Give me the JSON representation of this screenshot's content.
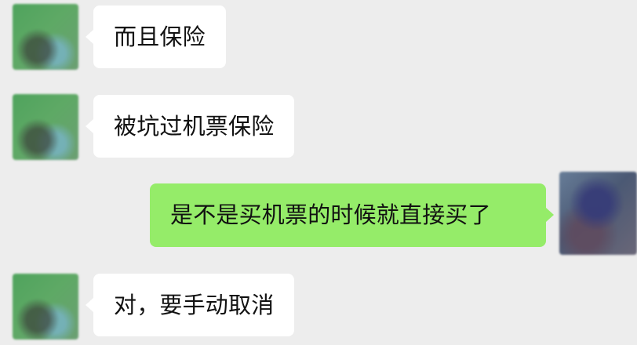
{
  "chat": {
    "messages": [
      {
        "sender": "left",
        "text": "而且保险"
      },
      {
        "sender": "left",
        "text": "被坑过机票保险"
      },
      {
        "sender": "right",
        "text": "是不是买机票的时候就直接买了"
      },
      {
        "sender": "left",
        "text": "对，要手动取消"
      }
    ]
  },
  "colors": {
    "background": "#ededed",
    "incoming_bubble": "#ffffff",
    "outgoing_bubble": "#95ec69"
  },
  "icons": {
    "incoming_avatar": "avatar",
    "outgoing_avatar": "avatar"
  }
}
